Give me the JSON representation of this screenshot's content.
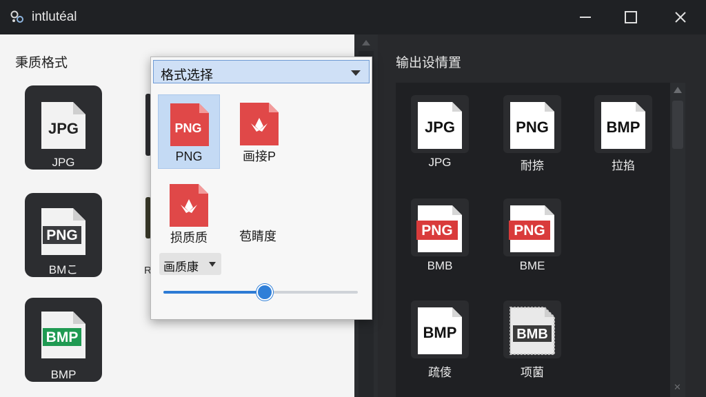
{
  "window": {
    "title": "intlutéal",
    "minimize_icon": "minimize-icon",
    "maximize_icon": "maximize-icon",
    "close_icon": "close-icon"
  },
  "left": {
    "heading": "秉质格式",
    "tiles": [
      {
        "doc": "JPG",
        "label": "JPG",
        "band": "#ffffff",
        "text": "#222222"
      },
      {
        "doc": "PNG",
        "label": "BMこ",
        "band": "#3a3b3e",
        "text": "#ffffff"
      },
      {
        "doc": "BMP",
        "label": "BMP",
        "band": "#1f9a52",
        "text": "#ffffff"
      }
    ],
    "peek_text": "R"
  },
  "popup": {
    "select_value": "格式选择",
    "options": [
      {
        "doc": "PNG",
        "label": "PNG",
        "selected": true
      },
      {
        "doc": "",
        "label": "画接P",
        "selected": false
      },
      {
        "doc": "",
        "label": "损质质",
        "selected": false
      }
    ],
    "plain_option": "苞睛度",
    "quality_label": "画质康",
    "slider_percent": 52,
    "accent": "#2d7bd5",
    "doc_red": "#e04848"
  },
  "right": {
    "heading": "输出设情置",
    "tiles": [
      {
        "doc": "JPG",
        "label": "JPG",
        "style": "white"
      },
      {
        "doc": "PNG",
        "label": "耐捺",
        "style": "white"
      },
      {
        "doc": "BMP",
        "label": "拉掐",
        "style": "white"
      },
      {
        "doc": "PNG",
        "label": "BMB",
        "style": "red"
      },
      {
        "doc": "PNG",
        "label": "BME",
        "style": "red"
      },
      {
        "doc": "BMP",
        "label": "疏倰",
        "style": "white"
      },
      {
        "doc": "BMB",
        "label": "项菌",
        "style": "stamp"
      }
    ]
  }
}
